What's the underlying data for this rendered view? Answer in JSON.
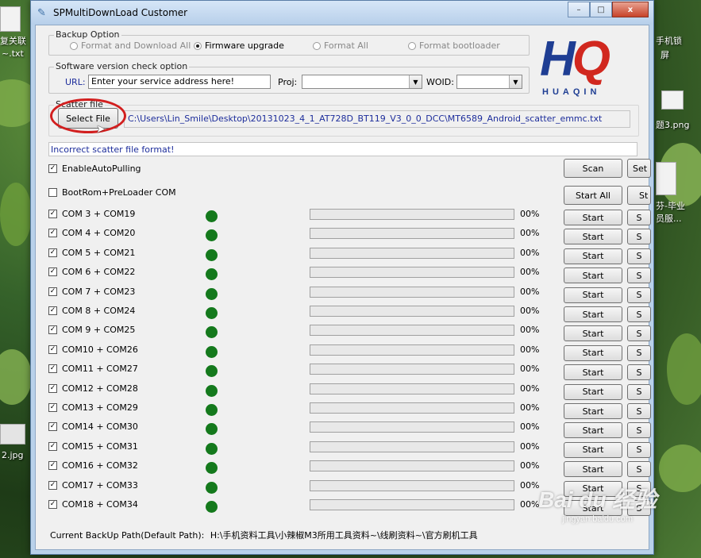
{
  "desktop": {
    "left_items": [
      "复关联",
      "~.txt",
      "2.jpg"
    ],
    "right_items": [
      "手机锁",
      "屏",
      "题3.png",
      "芬-毕业",
      "员服..."
    ]
  },
  "window": {
    "title": "SPMultiDownLoad Customer",
    "controls": {
      "minimize": "–",
      "maximize": "□",
      "close": "x"
    }
  },
  "backup_option": {
    "legend": "Backup Option",
    "options": [
      {
        "label": "Format and Download All",
        "selected": false
      },
      {
        "label": "Firmware upgrade",
        "selected": true
      },
      {
        "label": "Format All",
        "selected": false
      },
      {
        "label": "Format bootloader",
        "selected": false
      }
    ]
  },
  "version_check": {
    "legend": "Software version check option",
    "url_label": "URL:",
    "url_value": "Enter your service address here!",
    "proj_label": "Proj:",
    "proj_value": "",
    "woid_label": "WOID:",
    "woid_value": ""
  },
  "logo": {
    "mark_left": "H",
    "mark_right": "Q",
    "name": "HUAQIN"
  },
  "scatter": {
    "legend": "Scatter file",
    "select_button": "Select File",
    "path": "C:\\Users\\Lin_Smile\\Desktop\\20131023_4_1_AT728D_BT119_V3_0_0_DCC\\MT6589_Android_scatter_emmc.txt"
  },
  "status_message": "Incorrect scatter file format!",
  "options": {
    "auto_pulling": {
      "label": "EnableAutoPulling",
      "checked": true
    },
    "bootrom": {
      "label": "BootRom+PreLoader COM",
      "checked": false
    }
  },
  "buttons": {
    "scan": "Scan",
    "set": "Set I",
    "start_all": "Start All",
    "stop_all": "St",
    "row_start": "Start",
    "row_stop": "S"
  },
  "ports": [
    {
      "label": "COM 3 + COM19",
      "checked": true,
      "progress": "00%",
      "progress_value": 0
    },
    {
      "label": "COM 4 + COM20",
      "checked": true,
      "progress": "00%",
      "progress_value": 0
    },
    {
      "label": "COM 5 + COM21",
      "checked": true,
      "progress": "00%",
      "progress_value": 0
    },
    {
      "label": "COM 6 + COM22",
      "checked": true,
      "progress": "00%",
      "progress_value": 0
    },
    {
      "label": "COM 7 + COM23",
      "checked": true,
      "progress": "00%",
      "progress_value": 0
    },
    {
      "label": "COM 8 + COM24",
      "checked": true,
      "progress": "00%",
      "progress_value": 0
    },
    {
      "label": "COM 9 + COM25",
      "checked": true,
      "progress": "00%",
      "progress_value": 0
    },
    {
      "label": "COM10 + COM26",
      "checked": true,
      "progress": "00%",
      "progress_value": 0
    },
    {
      "label": "COM11 + COM27",
      "checked": true,
      "progress": "00%",
      "progress_value": 0
    },
    {
      "label": "COM12 + COM28",
      "checked": true,
      "progress": "00%",
      "progress_value": 0
    },
    {
      "label": "COM13 + COM29",
      "checked": true,
      "progress": "00%",
      "progress_value": 0
    },
    {
      "label": "COM14 + COM30",
      "checked": true,
      "progress": "00%",
      "progress_value": 0
    },
    {
      "label": "COM15 + COM31",
      "checked": true,
      "progress": "00%",
      "progress_value": 0
    },
    {
      "label": "COM16 + COM32",
      "checked": true,
      "progress": "00%",
      "progress_value": 0
    },
    {
      "label": "COM17 + COM33",
      "checked": true,
      "progress": "00%",
      "progress_value": 0
    },
    {
      "label": "COM18 + COM34",
      "checked": true,
      "progress": "00%",
      "progress_value": 0
    }
  ],
  "footer": {
    "backup_path_label": "Current BackUp Path(Default Path):",
    "backup_path_value": "H:\\手机资料工具\\小辣椒M3所用工具资料~\\线刷资料~\\官方刷机工具"
  },
  "watermark": {
    "brand": "Bai du 经验",
    "url": "jingyan.baidu.com"
  },
  "colors": {
    "led_ready": "#14791c",
    "link_blue": "#1d2d9b",
    "highlight_ring": "#d21f1f",
    "logo_blue": "#1f3e93",
    "logo_red": "#d1281f"
  }
}
